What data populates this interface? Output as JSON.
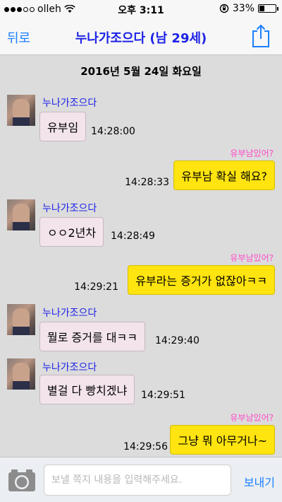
{
  "status_bar": {
    "carrier": "olleh",
    "time": "오후 3:11",
    "battery_percent": "33%",
    "battery_level": 0.33
  },
  "nav": {
    "back_label": "뒤로",
    "title": "누나가조으다 (남 29세)",
    "share_icon": "share-icon"
  },
  "date_header": "2016년 5월 24일 화요일",
  "sender_name": "누나가조으다",
  "out_label": "유부남있어?",
  "messages": [
    {
      "direction": "in",
      "text": "유부임",
      "time": "14:28:00"
    },
    {
      "direction": "out",
      "text": "유부남 확실 해요?",
      "time": "14:28:33"
    },
    {
      "direction": "in",
      "text": "ㅇㅇ2년차",
      "time": "14:28:49"
    },
    {
      "direction": "out",
      "text": "유부라는 증거가 없잖아ㅋㅋ",
      "time": "14:29:21"
    },
    {
      "direction": "in",
      "text": "뭘로 증거를 대ㅋㅋ",
      "time": "14:29:40"
    },
    {
      "direction": "in",
      "text": "별걸 다 빵치겠냐",
      "time": "14:29:51"
    },
    {
      "direction": "out",
      "text": "그냥 뭐 아무거나~",
      "time": "14:29:56"
    }
  ],
  "input_bar": {
    "camera_icon": "camera-icon",
    "placeholder": "보낼 쪽지 내용을 입력해주세요.",
    "value": "",
    "send_label": "보내기"
  },
  "colors": {
    "accent": "#1a7fff",
    "title": "#1d22e6",
    "incoming_bubble": "#f3e4ec",
    "outgoing_bubble": "#ffe40f",
    "out_label": "#ff47c8",
    "background": "#dcdcdc"
  }
}
